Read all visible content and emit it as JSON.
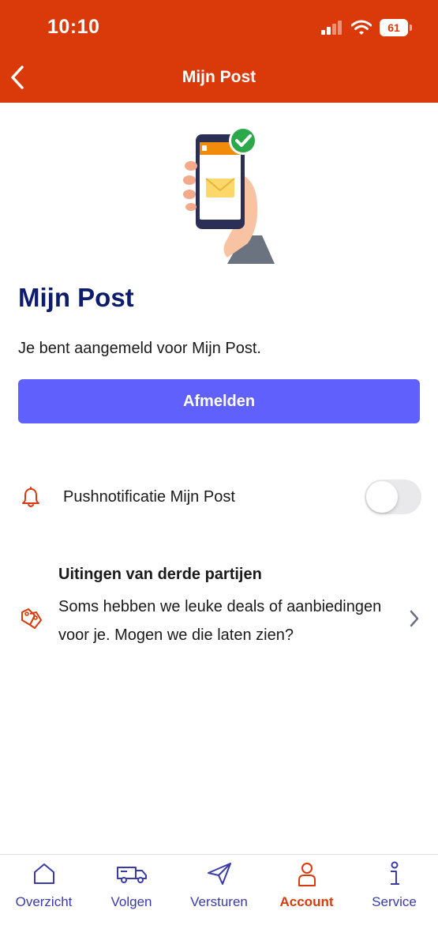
{
  "status_bar": {
    "time": "10:10",
    "battery": "61"
  },
  "header": {
    "title": "Mijn Post"
  },
  "main": {
    "title": "Mijn Post",
    "subtitle": "Je bent aangemeld voor Mijn Post.",
    "unsubscribe_label": "Afmelden"
  },
  "settings": {
    "push": {
      "label": "Pushnotificatie Mijn Post",
      "enabled": false
    },
    "third_party": {
      "title": "Uitingen van derde partijen",
      "description": "Soms hebben we leuke deals of aanbiedingen voor je. Mogen we die laten zien?"
    }
  },
  "tabs": [
    {
      "label": "Overzicht",
      "icon": "home-icon",
      "active": false
    },
    {
      "label": "Volgen",
      "icon": "van-icon",
      "active": false
    },
    {
      "label": "Versturen",
      "icon": "send-icon",
      "active": false
    },
    {
      "label": "Account",
      "icon": "user-icon",
      "active": true
    },
    {
      "label": "Service",
      "icon": "info-icon",
      "active": false
    }
  ],
  "colors": {
    "brand": "#da3a0a",
    "button": "#6060fc",
    "title": "#0d1c6b",
    "tab": "#3a3aa8"
  }
}
